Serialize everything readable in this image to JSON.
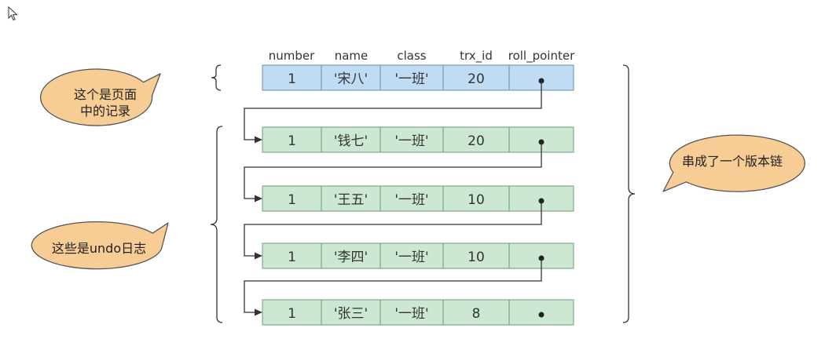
{
  "columns": [
    "number",
    "name",
    "class",
    "trx_id",
    "roll_pointer"
  ],
  "page_record": {
    "number": "1",
    "name": "'宋八'",
    "class": "'一班'",
    "trx_id": "20"
  },
  "undo_logs": [
    {
      "number": "1",
      "name": "'钱七'",
      "class": "'一班'",
      "trx_id": "20"
    },
    {
      "number": "1",
      "name": "'王五'",
      "class": "'一班'",
      "trx_id": "10"
    },
    {
      "number": "1",
      "name": "'李四'",
      "class": "'一班'",
      "trx_id": "10"
    },
    {
      "number": "1",
      "name": "'张三'",
      "class": "'一班'",
      "trx_id": "8"
    }
  ],
  "callouts": {
    "page_record_line1": "这个是页面",
    "page_record_line2": "中的记录",
    "undo_logs": "这些是undo日志",
    "version_chain": "串成了一个版本链"
  },
  "colors": {
    "page_row_fill": "#c0dcf4",
    "page_row_stroke": "#6b8cb0",
    "undo_row_fill": "#cde8d2",
    "undo_row_stroke": "#6f9a7a",
    "bubble_fill": "#f7cd95",
    "bubble_stroke": "#555555",
    "line": "#333333"
  }
}
